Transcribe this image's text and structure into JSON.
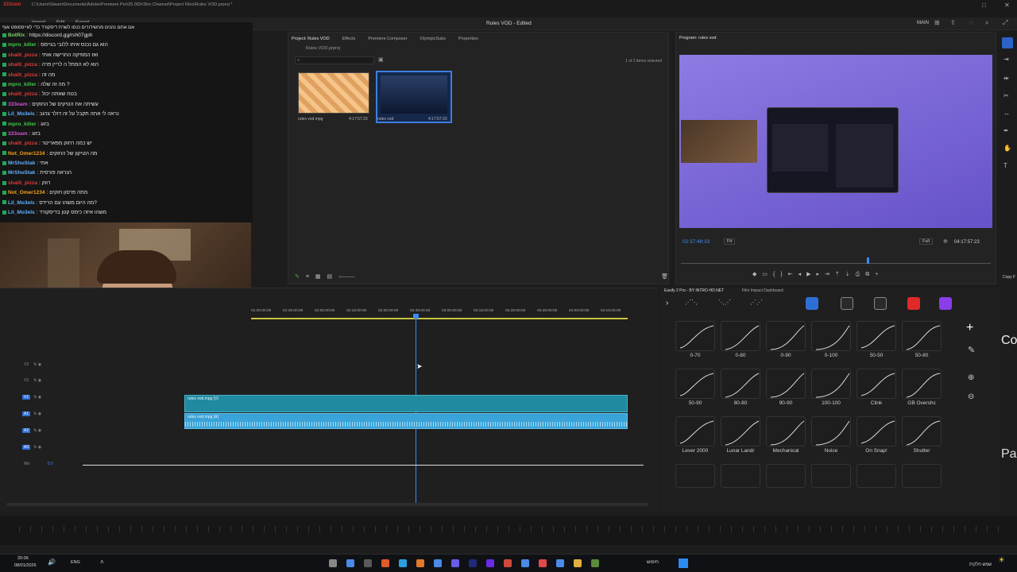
{
  "titlebar": {
    "path": "C:\\Users\\Steam\\Documents\\Adobe\\Premiere Pro\\25.0\\Dr\\Sho Channel\\Project Files\\Rules VOD.prproj *",
    "app_title": "Rules VOD - Edited",
    "workspace": "MAIN"
  },
  "menu": {
    "import": "Import",
    "edit": "Edit",
    "export": "Export"
  },
  "chat": {
    "discord": "https://discord.gg/rsh07gph",
    "pinned": "אם אתם נהנים מהשידורים כנסו לשרת דיסקורד כדי לאייפסופט אוף",
    "lines": [
      {
        "user": "BotRix",
        "color": "#7fd46a",
        "text": ": https://discord.gg/rsh07gph"
      },
      {
        "user": "mpro_killer",
        "color": "#43c84a",
        "text": ": הוא גם נכנס איתו ללובי בגיימס"
      },
      {
        "user": "shalit_pizza",
        "color": "#e03a3a",
        "text": ": ואז המוזיקה החרישה אותי"
      },
      {
        "user": "shalit_pizza",
        "color": "#e03a3a",
        "text": ": הוא לא המתל ה לריין פרה"
      },
      {
        "user": "shalit_pizza",
        "color": "#e03a3a",
        "text": ": מה זה"
      },
      {
        "user": "mpro_killer",
        "color": "#43c84a",
        "text": ": מה זה שלה ?"
      },
      {
        "user": "shalit_pizza",
        "color": "#e03a3a",
        "text": ": בטח שאתה יכול"
      },
      {
        "user": "333oam",
        "color": "#d44fd6",
        "text": ": עשיתה את הטיקים של החוקים"
      },
      {
        "user": "Lil_Mo3els",
        "color": "#5fb0ff",
        "text": ": נראה לי אתה תקבל על זה דולר צהוב"
      },
      {
        "user": "mpro_killer",
        "color": "#43c84a",
        "text": ": בזוג"
      },
      {
        "user": "333oam",
        "color": "#d44fd6",
        "text": ": בזוג"
      },
      {
        "user": "shalit_pizza",
        "color": "#e03a3a",
        "text": ": יש כמה רחוק מפאריטר"
      },
      {
        "user": "Not_Omer1234",
        "color": "#f0a020",
        "text": ": מה הטיקון של החוקים"
      },
      {
        "user": "MrShoStak",
        "color": "#5fb0ff",
        "text": ": אתי"
      },
      {
        "user": "MrShoStak",
        "color": "#5fb0ff",
        "text": ": הנראה פורסית"
      },
      {
        "user": "shalit_pizza",
        "color": "#e03a3a",
        "text": ": רווק"
      },
      {
        "user": "Not_Omer1234",
        "color": "#f0a020",
        "text": ": מתה פרסון חוקים"
      },
      {
        "user": "Lil_Mo3els",
        "color": "#5fb0ff",
        "text": ": מה היום משהו עם הרידס?"
      },
      {
        "user": "Lil_Mo3els",
        "color": "#5fb0ff",
        "text": ": משהו איזה כימס קטן בדיסקורד"
      }
    ]
  },
  "project": {
    "tabs": [
      "Project: Rules VOD",
      "Effects",
      "Premiere Composer",
      "OlympicSubs",
      "Properties"
    ],
    "breadcrumb": "Rules VOD.prproj",
    "search_placeholder": "",
    "count": "1 of 2 items selected",
    "items": [
      {
        "name": "rules vod.mpg",
        "duration": "4:17:57:23"
      },
      {
        "name": "rules vod",
        "duration": "4:17:57:23"
      }
    ]
  },
  "program": {
    "title": "Program: rules vod",
    "timecode": "02:37:48:33",
    "fit": "Fit",
    "full": "Full",
    "duration": "04:17:57:23"
  },
  "timeline": {
    "ruler": [
      "01:30:00:00",
      "01:45:00:00",
      "02:00:00:00",
      "02:15:00:00",
      "02:30:00:00",
      "02:45:00:00",
      "03:00:00:00",
      "03:15:00:00",
      "03:30:00:00",
      "03:45:00:00",
      "04:00:00:00",
      "04:15:00:00"
    ],
    "tracks": [
      "V3",
      "V2",
      "V1",
      "A1",
      "A2",
      "A3",
      "Mix"
    ],
    "mix_value": "0.0",
    "video_clip": "rules vod.mpg [V]",
    "audio_clip": "rules vod.mpg [A]"
  },
  "easify": {
    "tabs": [
      "Easify 2 Pro - BY INTRO-HD.NET",
      "Film Impact Dashboard"
    ],
    "curves": [
      "0-70",
      "0-80",
      "0-90",
      "0-100",
      "50-50",
      "50-80",
      "50-90",
      "80-80",
      "90-90",
      "100-100",
      "Clink",
      "GB Overshc",
      "Lever 2000",
      "Lunar Landr",
      "Mechanical",
      "Noice",
      "On Snap!",
      "Shutter"
    ],
    "side_co": "Co",
    "side_pa": "Pa",
    "side_cop": "Copy F"
  },
  "taskbar": {
    "time": "20:06",
    "date": "08/01/2026",
    "lang": "ENG",
    "search": "חיפוש",
    "weather": "שמש חלקית"
  }
}
